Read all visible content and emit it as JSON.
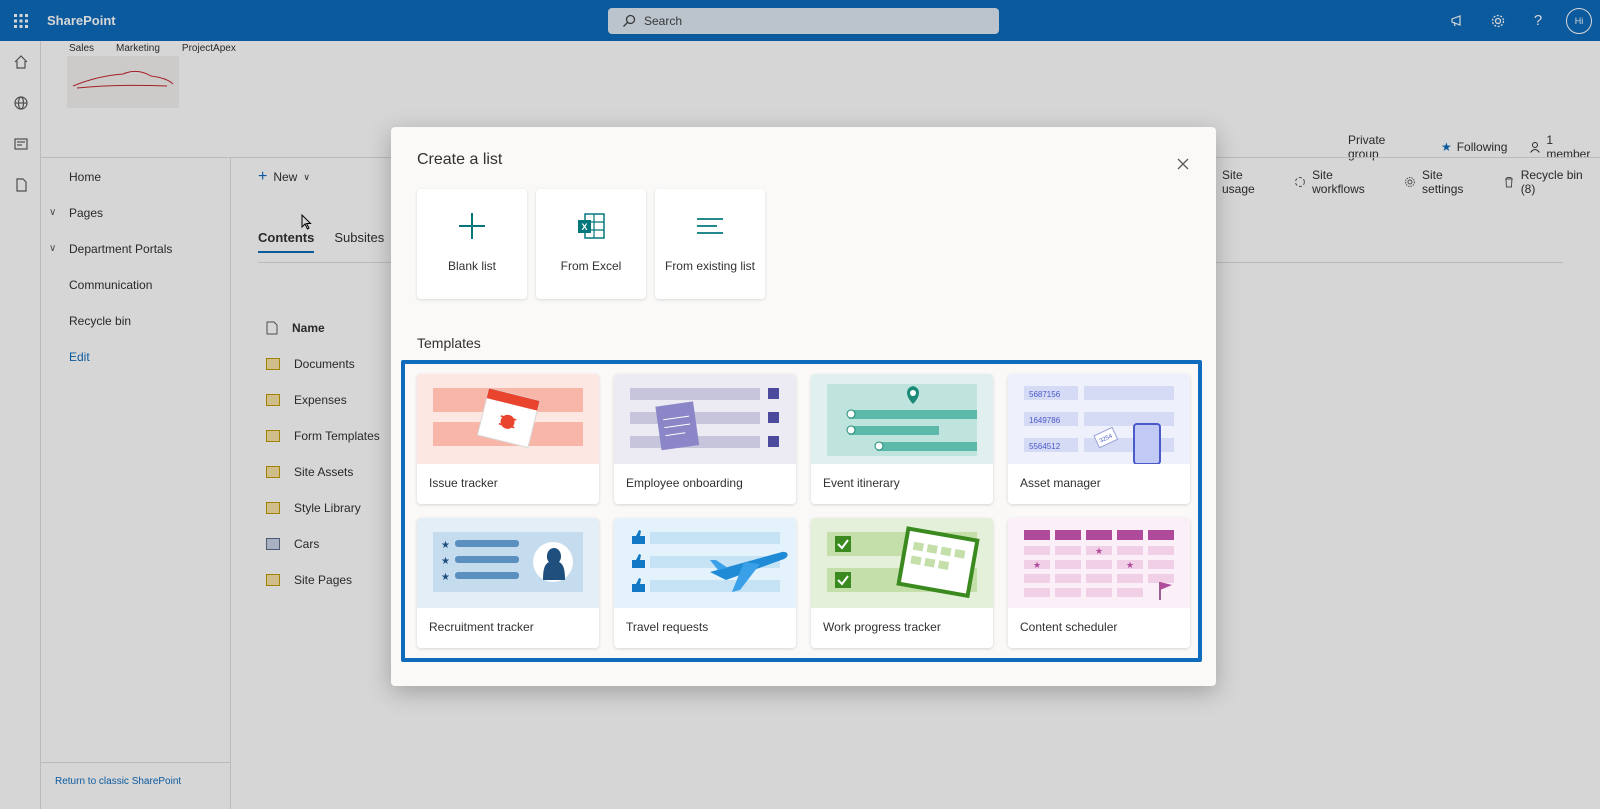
{
  "suitebar": {
    "app_name": "SharePoint",
    "search_placeholder": "Search",
    "avatar_initials": "Hi"
  },
  "hub_nav": [
    "Sales",
    "Marketing",
    "ProjectApex"
  ],
  "site_meta": {
    "privacy": "Private group",
    "following": "Following",
    "members": "1 member"
  },
  "leftnav": {
    "items": [
      {
        "label": "Home",
        "expand": false
      },
      {
        "label": "Pages",
        "expand": true
      },
      {
        "label": "Department Portals",
        "expand": true
      },
      {
        "label": "Communication",
        "expand": false
      },
      {
        "label": "Recycle bin",
        "expand": false
      }
    ],
    "edit": "Edit",
    "classic": "Return to classic SharePoint"
  },
  "commandbar": {
    "new": "New",
    "site_usage": "Site usage",
    "site_workflows": "Site workflows",
    "site_settings": "Site settings",
    "recycle_bin": "Recycle bin (8)"
  },
  "tabs": [
    "Contents",
    "Subsites"
  ],
  "filelist": {
    "header": "Name",
    "items": [
      "Documents",
      "Expenses",
      "Form Templates",
      "Site Assets",
      "Style Library",
      "Cars",
      "Site Pages"
    ]
  },
  "dialog": {
    "title": "Create a list",
    "create_options": [
      "Blank list",
      "From Excel",
      "From existing list"
    ],
    "templates_heading": "Templates",
    "templates": [
      {
        "label": "Issue tracker",
        "color": "#fde7e2",
        "icon": "bug-calendar"
      },
      {
        "label": "Employee onboarding",
        "color": "#ecebf3",
        "icon": "clipboard-check"
      },
      {
        "label": "Event itinerary",
        "color": "#dff0ee",
        "icon": "map-pin"
      },
      {
        "label": "Asset manager",
        "color": "#eef0fb",
        "icon": "phone-tag"
      },
      {
        "label": "Recruitment tracker",
        "color": "#e3eef7",
        "icon": "person-profile"
      },
      {
        "label": "Travel requests",
        "color": "#e4f2fb",
        "icon": "airplane"
      },
      {
        "label": "Work progress tracker",
        "color": "#e4f0d9",
        "icon": "progress-board"
      },
      {
        "label": "Content scheduler",
        "color": "#fbf0f7",
        "icon": "calendar-grid"
      }
    ]
  }
}
